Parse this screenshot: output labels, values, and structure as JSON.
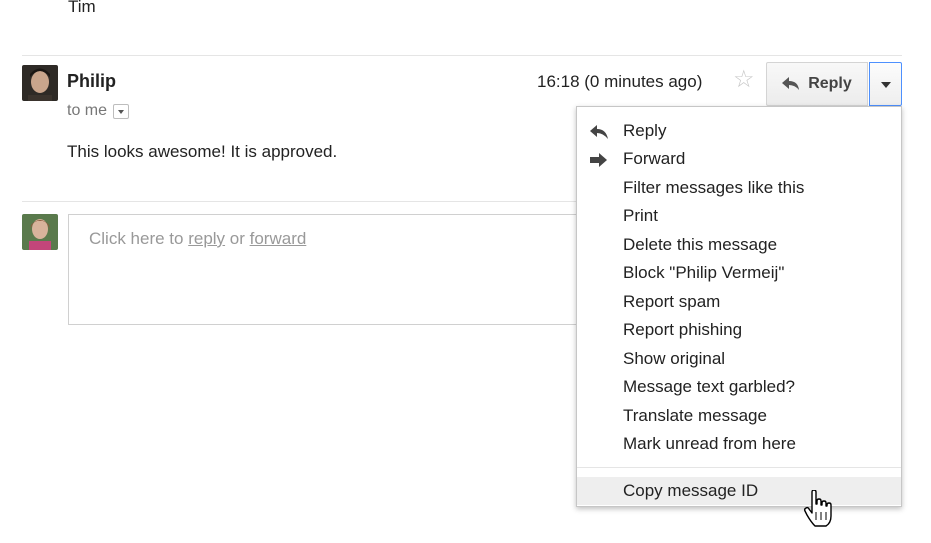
{
  "previous_message": {
    "signature": "Tim"
  },
  "message": {
    "sender_name": "Philip",
    "recipient_label": "to me",
    "timestamp": "16:18 (0 minutes ago)",
    "body": "This looks awesome! It is approved.",
    "reply_label": "Reply"
  },
  "compose": {
    "prefix": "Click here to ",
    "reply_link": "reply",
    "middle": " or ",
    "forward_link": "forward"
  },
  "menu": {
    "items": [
      {
        "label": "Reply",
        "icon": "reply-arrow-icon"
      },
      {
        "label": "Forward",
        "icon": "forward-arrow-icon"
      },
      {
        "label": "Filter messages like this"
      },
      {
        "label": "Print"
      },
      {
        "label": "Delete this message"
      },
      {
        "label": "Block \"Philip Vermeij\""
      },
      {
        "label": "Report spam"
      },
      {
        "label": "Report phishing"
      },
      {
        "label": "Show original"
      },
      {
        "label": "Message text garbled?"
      },
      {
        "label": "Translate message"
      },
      {
        "label": "Mark unread from here"
      },
      {
        "label": "Copy message ID",
        "state": "hovered"
      }
    ]
  },
  "colors": {
    "focus_border": "#4d90fe",
    "menu_hover": "#eeeeee",
    "star": "#c8c8c8"
  }
}
